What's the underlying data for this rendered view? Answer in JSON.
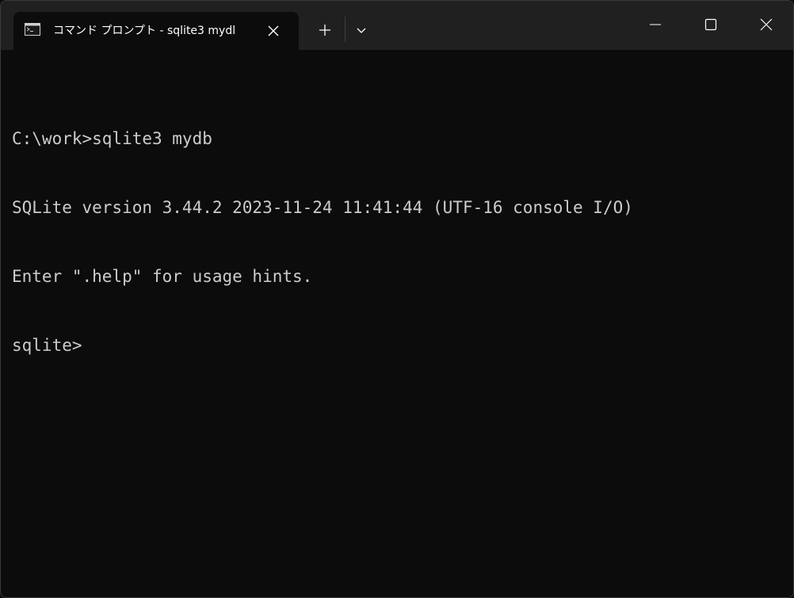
{
  "window": {
    "tab": {
      "title": "コマンド プロンプト - sqlite3  mydl",
      "icon": "terminal-icon"
    },
    "tab_controls": {
      "close_icon": "close-icon",
      "new_tab_icon": "plus-icon",
      "dropdown_icon": "chevron-down-icon"
    },
    "caption_buttons": {
      "minimize_icon": "minimize-icon",
      "maximize_icon": "maximize-icon",
      "close_icon": "close-icon"
    }
  },
  "terminal": {
    "lines": [
      "C:\\work>sqlite3 mydb",
      "SQLite version 3.44.2 2023-11-24 11:41:44 (UTF-16 console I/O)",
      "Enter \".help\" for usage hints.",
      "sqlite>"
    ]
  },
  "colors": {
    "background": "#0c0c0c",
    "titlebar": "#202020",
    "text": "#cccccc"
  }
}
